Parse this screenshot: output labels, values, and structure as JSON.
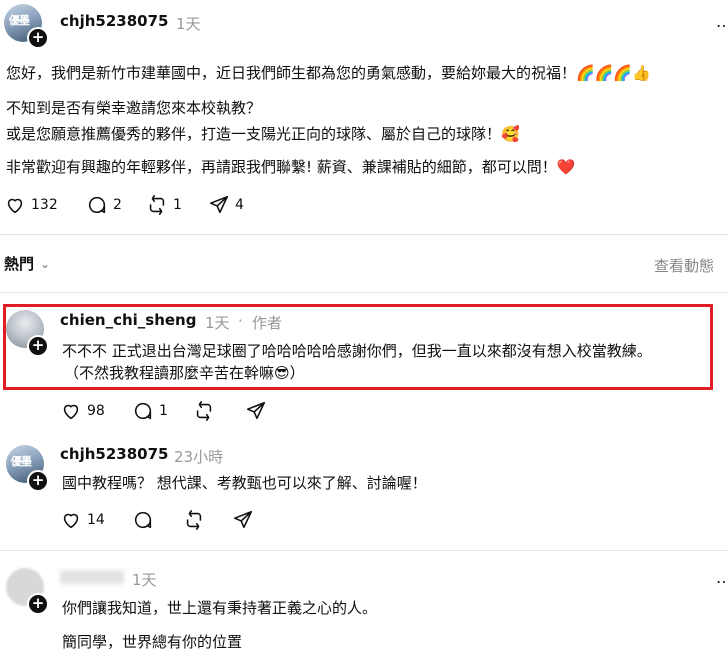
{
  "post": {
    "username": "chjh5238075",
    "time": "1天",
    "avatar_text": "優墨",
    "line1": "您好，我們是新竹市建華國中，近日我們師生都為您的勇氣感動，要給妳最大的祝福！🌈🌈🌈👍",
    "line2": "不知到是否有榮幸邀請您來本校執教？",
    "line3": "或是您願意推薦優秀的夥伴，打造一支陽光正向的球隊、屬於自己的球隊！🥰",
    "line4": "非常歡迎有興趣的年輕夥伴，再請跟我們聯繫! 薪資、兼課補貼的細節，都可以問！❤️",
    "likes": "132",
    "replies": "2",
    "reposts": "1",
    "shares": "4"
  },
  "sort": {
    "label": "熱門",
    "view_activity": "查看動態"
  },
  "comments": [
    {
      "username": "chien_chi_sheng",
      "time": "1天",
      "dot": "·",
      "author_badge": "作者",
      "line1": "不不不 正式退出台灣足球圈了哈哈哈哈哈感謝你們，但我一直以來都沒有想入校當教練。",
      "line2": "（不然我教程讀那麼辛苦在幹嘛😎）",
      "likes": "98",
      "replies": "1"
    },
    {
      "username": "chjh5238075",
      "time": "23小時",
      "avatar_text": "優墨",
      "line1": "國中教程嗎？ 想代課、考教甄也可以來了解、討論喔！",
      "likes": "14"
    },
    {
      "time": "1天",
      "line1": "你們讓我知道，世上還有秉持著正義之心的人。",
      "line2": "簡同學，世界總有你的位置"
    }
  ],
  "icons": {
    "like": "heart-icon",
    "reply": "comment-icon",
    "repost": "repost-icon",
    "share": "share-icon",
    "more": "more-icon",
    "sort": "chevron-down-icon"
  },
  "colors": {
    "highlight_border": "#e11d25",
    "muted_text": "#999999"
  }
}
